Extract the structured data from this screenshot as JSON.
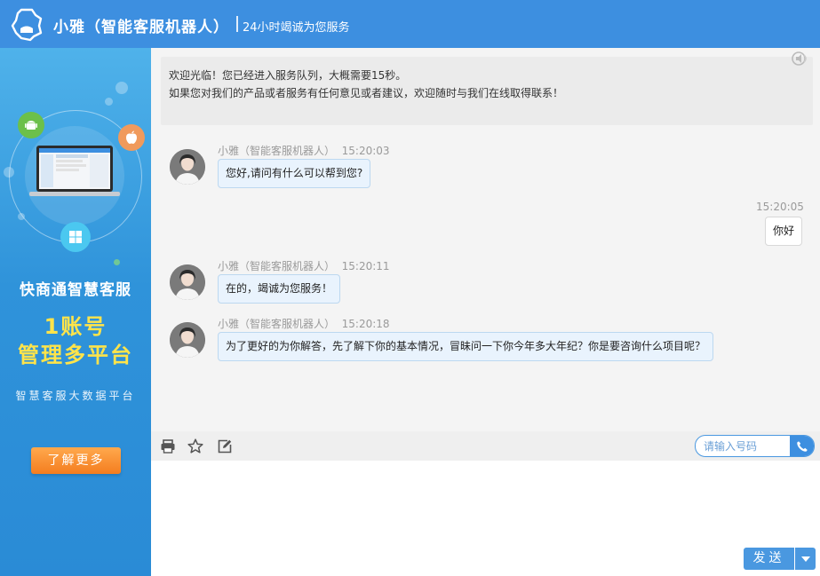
{
  "header": {
    "title": "小雅（智能客服机器人）",
    "slogan": "24小时竭诚为您服务"
  },
  "sidebar": {
    "brand": "快商通智慧客服",
    "headline_1": "1账号",
    "headline_2": "管理多平台",
    "tagline": "智慧客服大数据平台",
    "cta": "了解更多"
  },
  "notice": {
    "line1": "欢迎光临！您已经进入服务队列，大概需要15秒。",
    "line2": "如果您对我们的产品或者服务有任何意见或者建议，欢迎随时与我们在线取得联系！"
  },
  "messages": [
    {
      "sender": "小雅（智能客服机器人）",
      "time": "15:20:03",
      "text": "您好,请问有什么可以帮到您?"
    },
    {
      "sender": "",
      "time": "15:20:05",
      "text": "你好"
    },
    {
      "sender": "小雅（智能客服机器人）",
      "time": "15:20:11",
      "text": "在的，竭诚为您服务！"
    },
    {
      "sender": "小雅（智能客服机器人）",
      "time": "15:20:18",
      "text": "为了更好的为你解答，先了解下你的基本情况，冒昧问一下你今年多大年纪？你是要咨询什么项目呢？"
    }
  ],
  "toolbar": {
    "phone_placeholder": "请输入号码",
    "icons": [
      "print-icon",
      "star-icon",
      "edit-icon",
      "phone-icon"
    ]
  },
  "composer": {
    "send_label": "发送"
  },
  "colors": {
    "header": "#3d8fe0",
    "bubble_bot": "#e9f3fd",
    "accent_orange": "#f47d1f",
    "headline_yellow": "#ffe44a"
  }
}
